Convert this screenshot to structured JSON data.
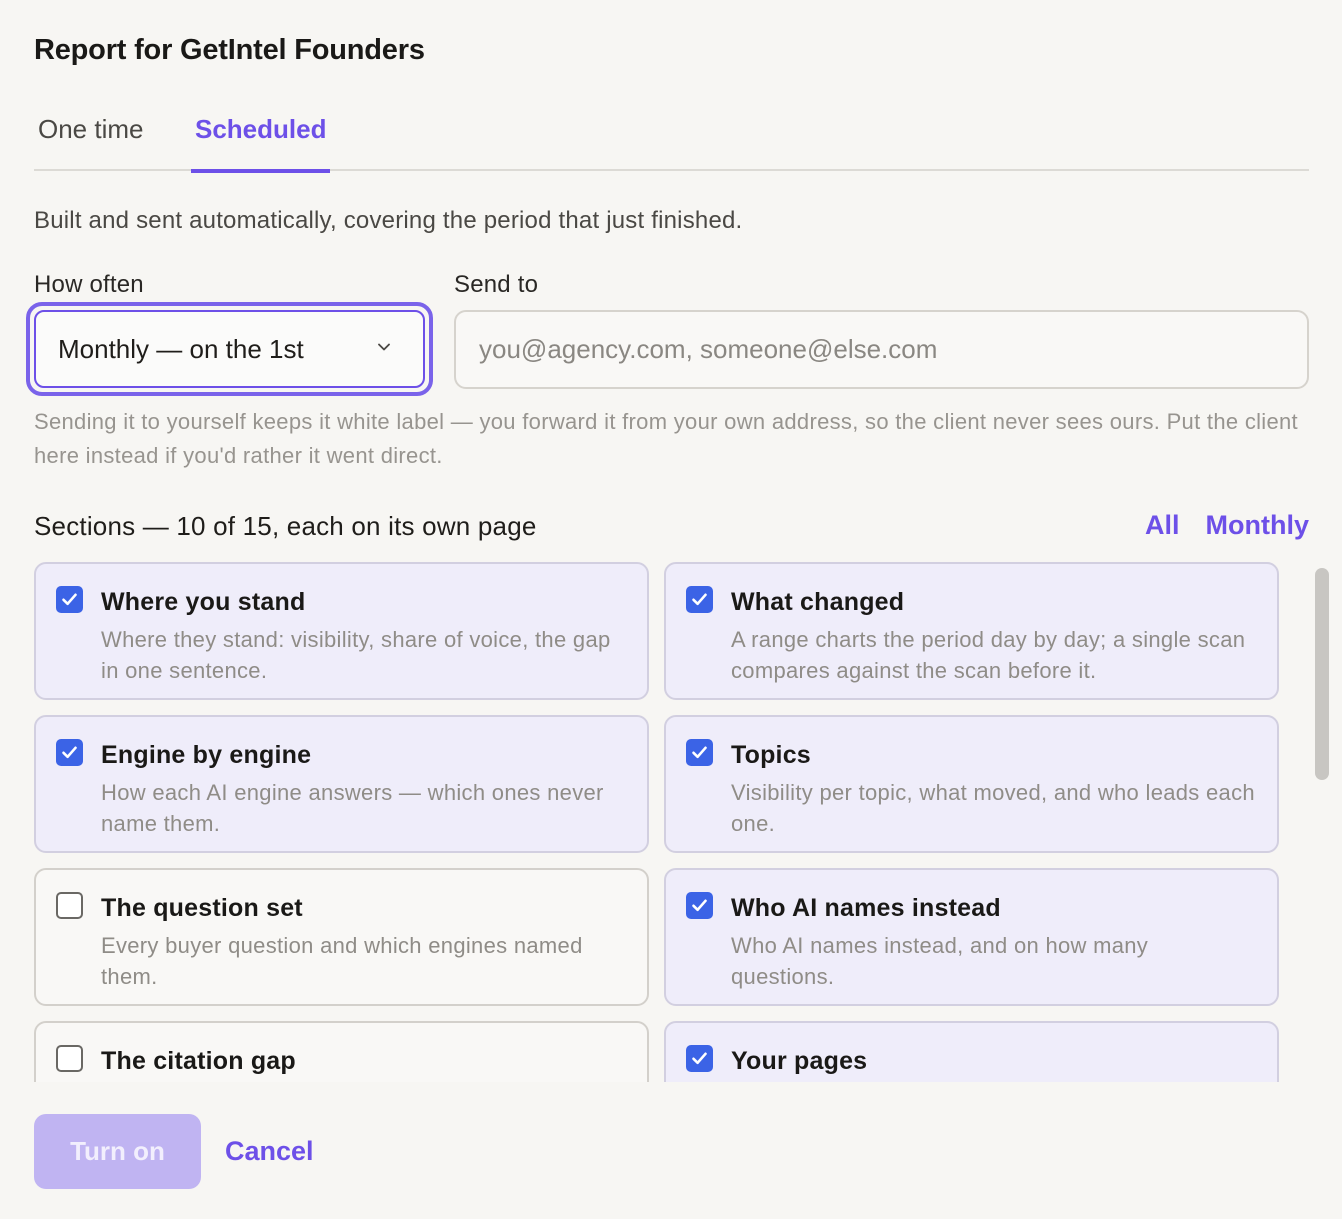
{
  "dialog": {
    "title": "Report for GetIntel Founders",
    "tabs": [
      {
        "label": "One time",
        "active": false
      },
      {
        "label": "Scheduled",
        "active": true
      }
    ],
    "subtitle": "Built and sent automatically, covering the period that just finished.",
    "accent_color": "#6d50e8"
  },
  "form": {
    "how_often_label": "How often",
    "how_often_value": "Monthly — on the 1st",
    "send_to_label": "Send to",
    "send_to_placeholder": "you@agency.com, someone@else.com",
    "send_to_value": "",
    "hint": "Sending it to yourself keeps it white label — you forward it from your own address, so the client never sees ours. Put the client here instead if you'd rather it went direct."
  },
  "sections": {
    "label": "Sections — 10 of 15, each on its own page",
    "links": [
      "All",
      "Monthly"
    ],
    "items": [
      {
        "title": "Where you stand",
        "description": "Where they stand: visibility, share of voice, the gap in one sentence.",
        "checked": true
      },
      {
        "title": "What changed",
        "description": "A range charts the period day by day; a single scan compares against the scan before it.",
        "checked": true
      },
      {
        "title": "Engine by engine",
        "description": "How each AI engine answers — which ones never name them.",
        "checked": true
      },
      {
        "title": "Topics",
        "description": "Visibility per topic, what moved, and who leads each one.",
        "checked": true
      },
      {
        "title": "The question set",
        "description": "Every buyer question and which engines named them.",
        "checked": false
      },
      {
        "title": "Who AI names instead",
        "description": "Who AI names instead, and on how many questions.",
        "checked": true
      },
      {
        "title": "The citation gap",
        "description": "",
        "checked": false
      },
      {
        "title": "Your pages",
        "description": "",
        "checked": true
      }
    ],
    "checkbox_color": "#3b63e6"
  },
  "footer": {
    "primary_label": "Turn on",
    "cancel_label": "Cancel"
  }
}
